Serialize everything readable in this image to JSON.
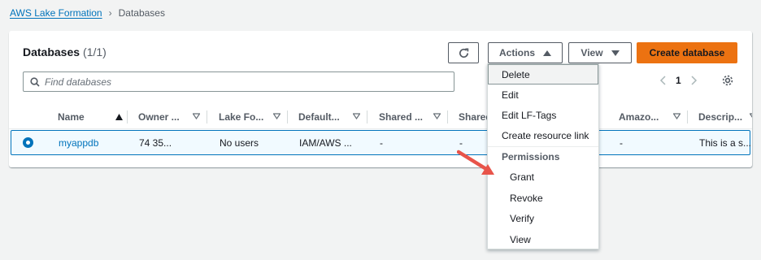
{
  "breadcrumb": {
    "root": "AWS Lake Formation",
    "current": "Databases"
  },
  "panel": {
    "title": "Databases",
    "count": "(1/1)"
  },
  "toolbar": {
    "actions_label": "Actions",
    "view_label": "View",
    "create_label": "Create database"
  },
  "search": {
    "placeholder": "Find databases"
  },
  "pagination": {
    "page": "1"
  },
  "table": {
    "columns": [
      "Name",
      "Owner ...",
      "Lake Fo...",
      "Default...",
      "Shared ...",
      "Shared",
      "Amazo...",
      "Descrip..."
    ],
    "rows": [
      {
        "name": "myappdb",
        "owner": "74      35...",
        "lake_formation": "No users",
        "default": "IAM/AWS ...",
        "shared1": "-",
        "shared2": "-",
        "amazon": "-",
        "description": "This is a s..."
      }
    ]
  },
  "actions_menu": {
    "items": [
      "Delete",
      "Edit",
      "Edit LF-Tags",
      "Create resource link"
    ],
    "group_label": "Permissions",
    "permission_items": [
      "Grant",
      "Revoke",
      "Verify",
      "View"
    ]
  },
  "colors": {
    "accent": "#0073bb",
    "primary_button": "#ec7211",
    "annotation_arrow": "#e8544a"
  }
}
